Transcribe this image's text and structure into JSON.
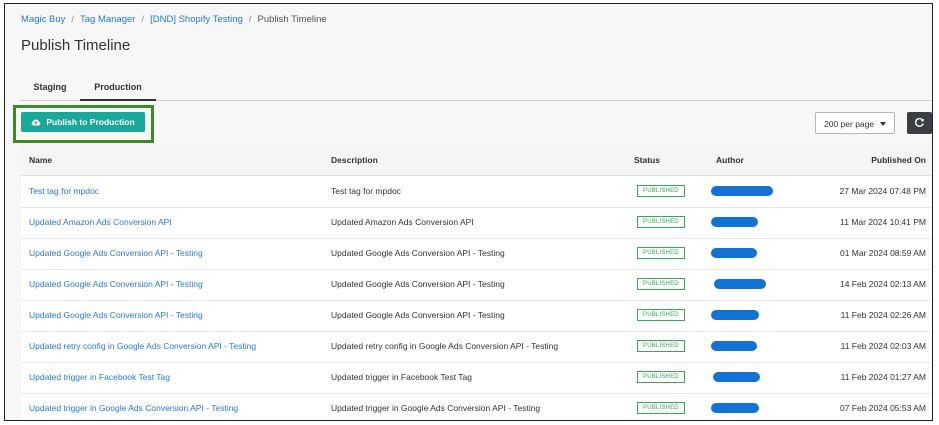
{
  "breadcrumb": {
    "items": [
      "Magic Buy",
      "Tag Manager",
      "[DND] Shopify Testing"
    ],
    "current": "Publish Timeline"
  },
  "page": {
    "title": "Publish Timeline"
  },
  "tabs": [
    {
      "label": "Staging",
      "active": false
    },
    {
      "label": "Production",
      "active": true
    }
  ],
  "toolbar": {
    "publish_label": "Publish to Production",
    "per_page": "200 per page",
    "publish_icon": "cloud-upload-icon",
    "refresh_icon": "refresh-icon"
  },
  "colors": {
    "accent": "#1aa89b",
    "link": "#2a7ac7",
    "status_published": "#3aa65a",
    "highlight_border": "#3d8b26",
    "author_redaction": "#1273d4"
  },
  "table": {
    "columns": {
      "name": "Name",
      "description": "Description",
      "status": "Status",
      "author": "Author",
      "published_on": "Published On"
    },
    "rows": [
      {
        "name": "Test tag for mpdoc",
        "description": "Test tag for mpdoc",
        "status": "PUBLISHED",
        "published_on": "27 Mar 2024 07:48 PM"
      },
      {
        "name": "Updated Amazon Ads Conversion API",
        "description": "Updated Amazon Ads Conversion API",
        "status": "PUBLISHED",
        "published_on": "11 Mar 2024 10:41 PM"
      },
      {
        "name": "Updated Google Ads Conversion API - Testing",
        "description": "Updated Google Ads Conversion API - Testing",
        "status": "PUBLISHED",
        "published_on": "01 Mar 2024 08:59 AM"
      },
      {
        "name": "Updated Google Ads Conversion API - Testing",
        "description": "Updated Google Ads Conversion API - Testing",
        "status": "PUBLISHED",
        "published_on": "14 Feb 2024 02:13 AM"
      },
      {
        "name": "Updated Google Ads Conversion API - Testing",
        "description": "Updated Google Ads Conversion API - Testing",
        "status": "PUBLISHED",
        "published_on": "11 Feb 2024 02:26 AM"
      },
      {
        "name": "Updated retry config in Google Ads Conversion API - Testing",
        "description": "Updated retry config in Google Ads Conversion API - Testing",
        "status": "PUBLISHED",
        "published_on": "11 Feb 2024 02:03 AM"
      },
      {
        "name": "Updated trigger in Facebook Test Tag",
        "description": "Updated trigger in Facebook Test Tag",
        "status": "PUBLISHED",
        "published_on": "11 Feb 2024 01:27 AM"
      },
      {
        "name": "Updated trigger in Google Ads Conversion API - Testing",
        "description": "Updated trigger in Google Ads Conversion API - Testing",
        "status": "PUBLISHED",
        "published_on": "07 Feb 2024 05:53 AM"
      }
    ]
  }
}
